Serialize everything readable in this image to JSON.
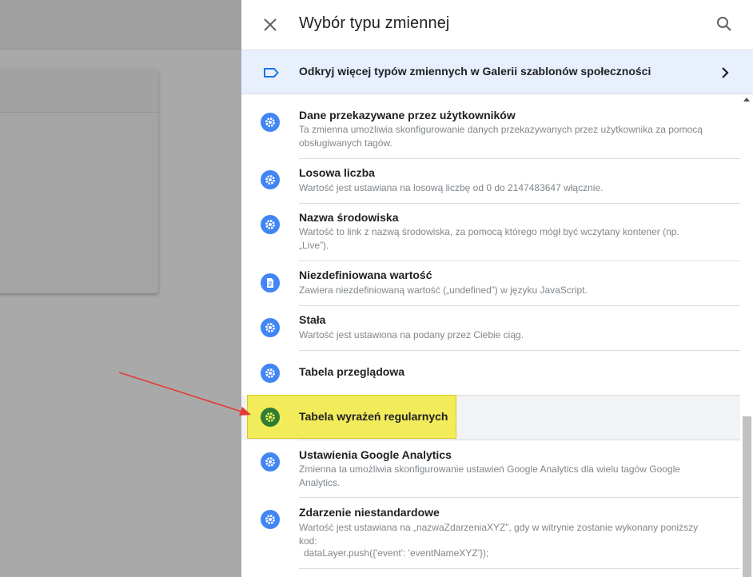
{
  "panel": {
    "title": "Wybór typu zmiennej",
    "close_icon": "close-icon",
    "search_icon": "search-icon"
  },
  "gallery": {
    "label": "Odkryj więcej typów zmiennych w Galerii szablonów społeczności",
    "icon": "tag-icon",
    "chevron": "chevron-right-icon"
  },
  "items": [
    {
      "title": "Dane przekazywane przez użytkowników",
      "desc": "Ta zmienna umożliwia skonfigurowanie danych przekazywanych przez użytkownika za pomocą obsługiwanych tagów.",
      "icon": "gear-icon"
    },
    {
      "title": "Losowa liczba",
      "desc": "Wartość jest ustawiana na losową liczbę od 0 do 2147483647 włącznie.",
      "icon": "gear-icon"
    },
    {
      "title": "Nazwa środowiska",
      "desc": "Wartość to link z nazwą środowiska, za pomocą którego mógł być wczytany kontener (np. „Live”).",
      "icon": "gear-icon"
    },
    {
      "title": "Niezdefiniowana wartość",
      "desc": "Zawiera niezdefiniowaną wartość („undefined”) w języku JavaScript.",
      "icon": "document-icon"
    },
    {
      "title": "Stała",
      "desc": "Wartość jest ustawiona na podany przez Ciebie ciąg.",
      "icon": "gear-icon"
    },
    {
      "title": "Tabela przeglądowa",
      "desc": "",
      "icon": "gear-icon"
    },
    {
      "title": "Tabela wyrażeń regularnych",
      "desc": "",
      "icon": "gear-icon"
    },
    {
      "title": "Ustawienia Google Analytics",
      "desc": "Zmienna ta umożliwia skonfigurowanie ustawień Google Analytics dla wielu tagów Google Analytics.",
      "icon": "gear-icon"
    },
    {
      "title": "Zdarzenie niestandardowe",
      "desc_line1": "Wartość jest ustawiana na „nazwaZdarzeniaXYZ”, gdy w witrynie zostanie wykonany poniższy kod:",
      "desc_line2": "dataLayer.push({'event': 'eventNameXYZ'});",
      "icon": "gear-icon"
    }
  ],
  "colors": {
    "accent_blue": "#4285f4",
    "highlight_yellow": "#f2ec5a",
    "highlight_icon_green": "#34a853",
    "annotation_arrow": "#e53935",
    "banner_bg": "#e8f0fe"
  }
}
